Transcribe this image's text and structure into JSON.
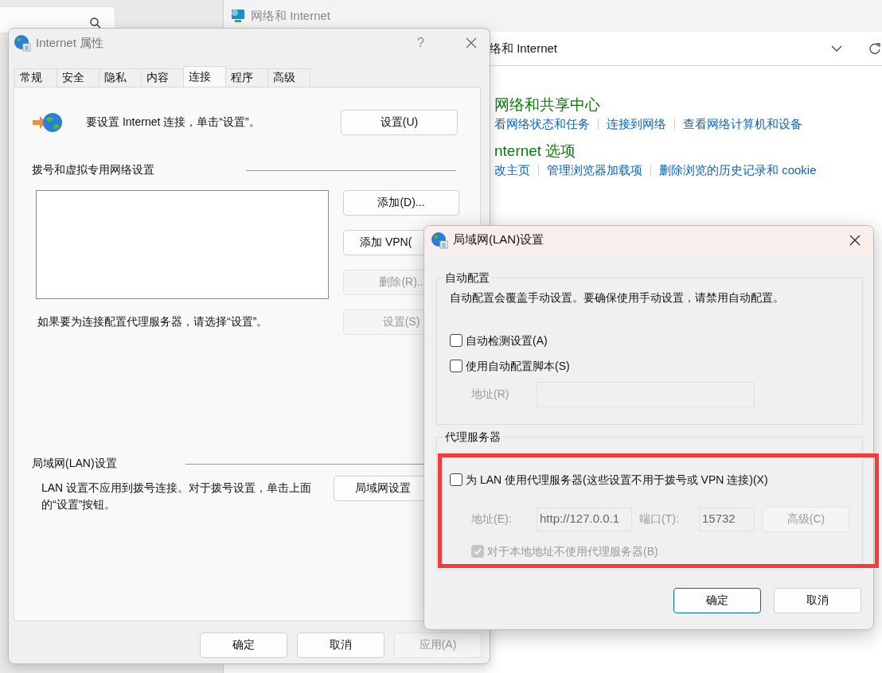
{
  "background_window": {
    "title": "网络和 Internet",
    "address": "络和 Internet",
    "sections": [
      {
        "heading": "网络和共享中心",
        "links": [
          "看网络状态和任务",
          "连接到网络",
          "查看网络计算机和设备"
        ]
      },
      {
        "heading": "nternet 选项",
        "links": [
          "改主页",
          "管理浏览器加载项",
          "删除浏览的历史记录和 cookie"
        ]
      }
    ]
  },
  "internet_properties": {
    "title": "Internet 属性",
    "help": "?",
    "tabs": [
      {
        "label": "常规",
        "selected": false
      },
      {
        "label": "安全",
        "selected": false
      },
      {
        "label": "隐私",
        "selected": false
      },
      {
        "label": "内容",
        "selected": false
      },
      {
        "label": "连接",
        "selected": true
      },
      {
        "label": "程序",
        "selected": false
      },
      {
        "label": "高级",
        "selected": false
      }
    ],
    "setup": {
      "text": "要设置 Internet 连接，单击“设置”。",
      "button": "设置(U)"
    },
    "dialup": {
      "heading": "拨号和虚拟专用网络设置",
      "buttons": [
        {
          "label": "添加(D)...",
          "disabled": false
        },
        {
          "label": "添加 VPN(",
          "disabled": false
        },
        {
          "label": "删除(R)..",
          "disabled": true
        },
        {
          "label": "设置(S)",
          "disabled": true
        }
      ],
      "hint": "如果要为连接配置代理服务器，请选择“设置”。"
    },
    "lan": {
      "heading": "局域网(LAN)设置",
      "text": "LAN 设置不应用到拨号连接。对于拨号设置，单击上面的“设置”按钮。",
      "button": "局域网设置"
    },
    "buttons": [
      {
        "label": "确定",
        "disabled": false
      },
      {
        "label": "取消",
        "disabled": false
      },
      {
        "label": "应用(A)",
        "disabled": true
      }
    ]
  },
  "lan_dialog": {
    "title": "局域网(LAN)设置",
    "auto_config": {
      "heading": "自动配置",
      "note": "自动配置会覆盖手动设置。要确保使用手动设置，请禁用自动配置。",
      "options": [
        {
          "label": "自动检测设置(A)",
          "checked": false
        },
        {
          "label": "使用自动配置脚本(S)",
          "checked": false
        }
      ],
      "script_address": {
        "label": "地址(R)",
        "disabled": true
      }
    },
    "proxy": {
      "heading": "代理服务器",
      "highlighted": true,
      "disabled": true,
      "use_proxy": {
        "label": "为 LAN 使用代理服务器(这些设置不用于拨号或 VPN 连接)(X)",
        "checked": false
      },
      "address": {
        "label": "地址(E):",
        "value": "http://127.0.0.1"
      },
      "port": {
        "label": "端口(T):",
        "value": "15732"
      },
      "advanced_button": "高级(C)",
      "bypass_local": {
        "label": "对于本地地址不使用代理服务器(B)",
        "checked": true
      }
    },
    "buttons": [
      {
        "label": "确定",
        "default": true
      },
      {
        "label": "取消",
        "default": false
      }
    ]
  }
}
